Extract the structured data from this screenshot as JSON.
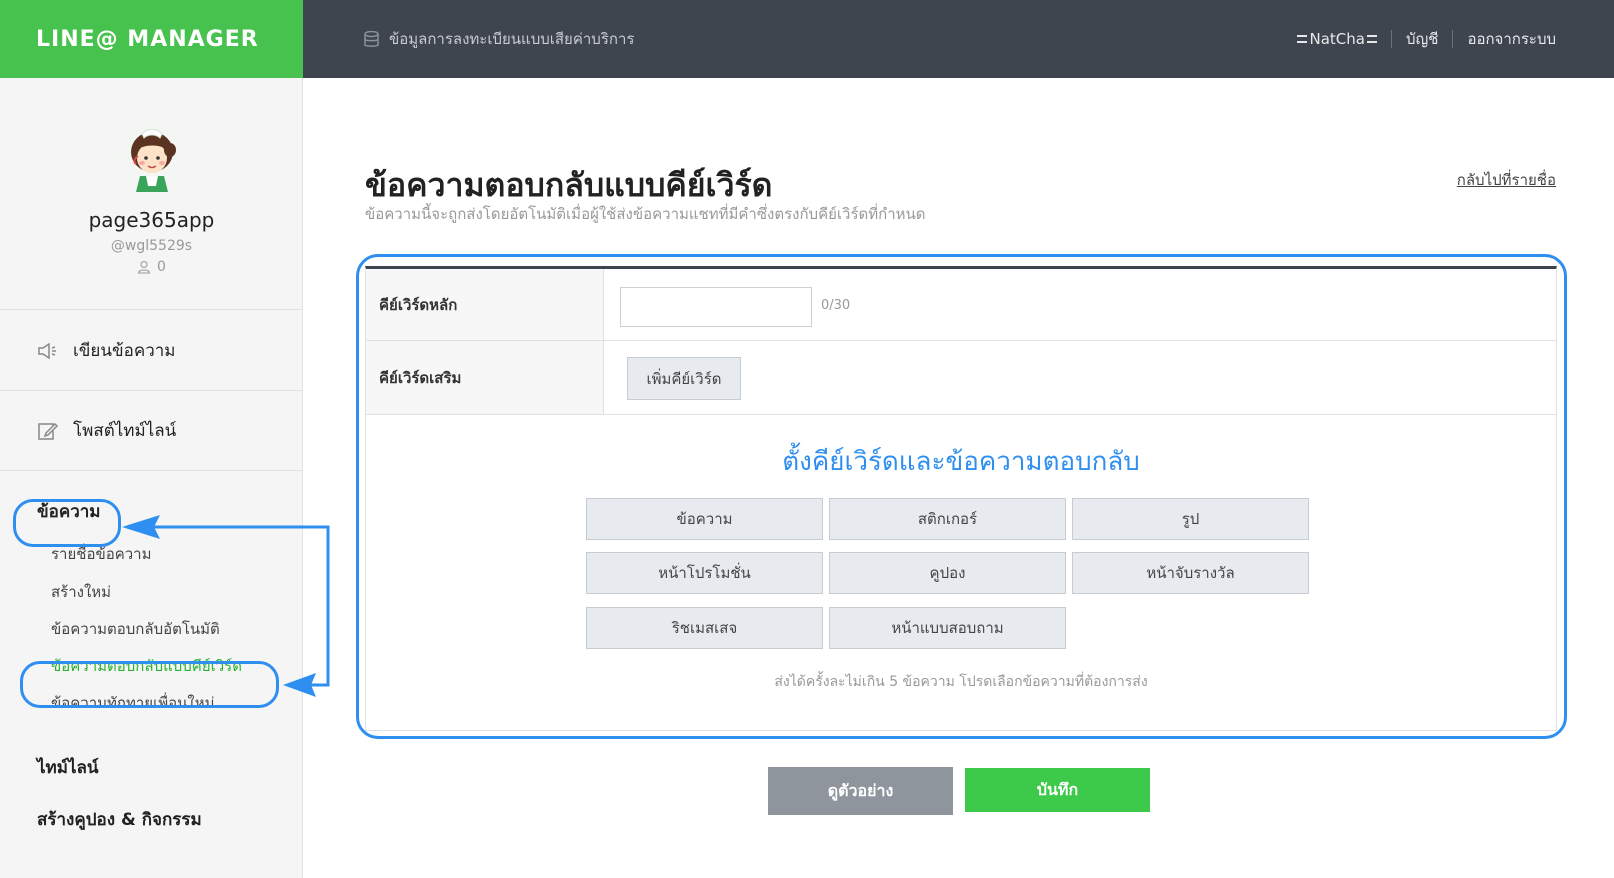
{
  "header": {
    "brand": "LINE@ MANAGER",
    "center_link": "ข้อมูลการลงทะเบียนแบบเสียค่าบริการ",
    "user_name": "NatCha",
    "account_link": "บัญชี",
    "logout_link": "ออกจากระบบ"
  },
  "profile": {
    "name": "page365app",
    "id": "@wgl5529s",
    "friends_count": "0"
  },
  "sidebar": {
    "compose_label": "เขียนข้อความ",
    "post_timeline_label": "โพสต์ไทม์ไลน์",
    "messages_section": "ข้อความ",
    "messages_items": [
      "รายชื่อข้อความ",
      "สร้างใหม่",
      "ข้อความตอบกลับอัตโนมัติ",
      "ข้อความตอบกลับแบบคีย์เวิร์ด",
      "ข้อความทักทายเพื่อนใหม่"
    ],
    "timeline_section": "ไทม์ไลน์",
    "coupons_section": "สร้างคูปอง & กิจกรรม"
  },
  "main": {
    "title": "ข้อความตอบกลับแบบคีย์เวิร์ด",
    "description": "ข้อความนี้จะถูกส่งโดยอัตโนมัติเมื่อผู้ใช้ส่งข้อความแชทที่มีคำซึ่งตรงกับคีย์เวิร์ดที่กำหนด",
    "back_link": "กลับไปที่รายชื่อ",
    "main_keyword_label": "คีย์เวิร์ดหลัก",
    "main_keyword_value": "",
    "main_keyword_counter": "0/30",
    "extra_keyword_label": "คีย์เวิร์ดเสริม",
    "add_keyword_button": "เพิ่มคีย์เวิร์ด",
    "set_title": "ตั้งคีย์เวิร์ดและข้อความตอบกลับ",
    "type_buttons": [
      "ข้อความ",
      "สติกเกอร์",
      "รูป",
      "หน้าโปรโมชั่น",
      "คูปอง",
      "หน้าจับรางวัล",
      "ริชเมสเสจ",
      "หน้าแบบสอบถาม"
    ],
    "hint": "ส่งได้ครั้งละไม่เกิน 5 ข้อความ โปรดเลือกข้อความที่ต้องการส่ง",
    "preview_button": "ดูตัวอย่าง",
    "save_button": "บันทึก"
  },
  "colors": {
    "brand_green": "#48c24e",
    "header_dark": "#3f454f",
    "highlight_blue": "#2f8ff0",
    "save_green": "#3dc94a",
    "preview_gray": "#8e959d"
  }
}
